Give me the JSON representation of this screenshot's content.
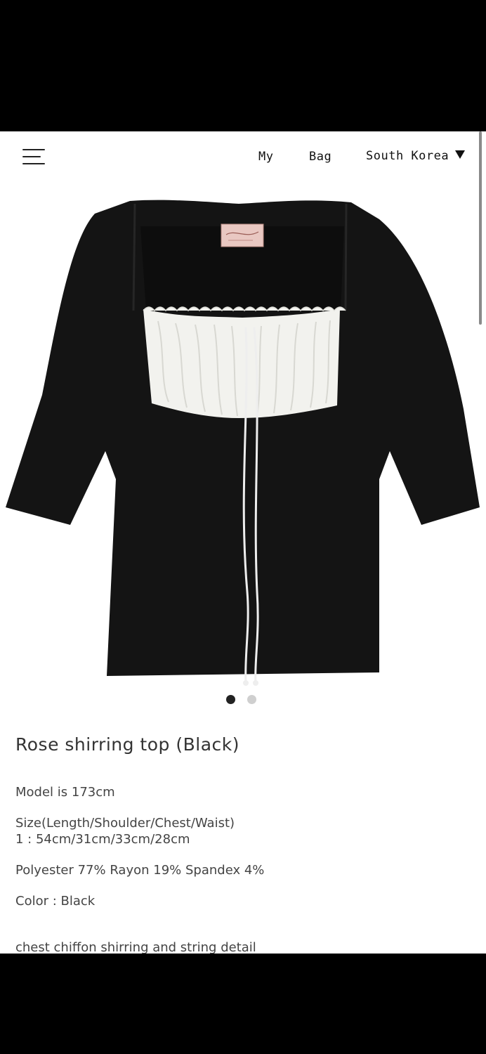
{
  "header": {
    "menu_icon": "hamburger-menu-icon",
    "my_label": "My",
    "bag_label": "Bag",
    "country_label": "South Korea",
    "country_icon": "caret-down-icon"
  },
  "product": {
    "image_alt": "Black square-neck top with white chiffon shirring panel and string tie",
    "carousel": {
      "current": 1,
      "total": 2
    },
    "title": "Rose shirring top (Black)",
    "model_info": "Model is 173cm",
    "size_label": "Size(Length/Shoulder/Chest/Waist)",
    "size_value": "1 : 54cm/31cm/33cm/28cm",
    "material": "Polyester 77% Rayon 19% Spandex 4%",
    "color": "Color : Black",
    "detail": "chest chiffon shirring and string detail"
  },
  "colors": {
    "background": "#ffffff",
    "frame": "#000000",
    "garment": "#141414",
    "chiffon": "#f2f2ee"
  }
}
